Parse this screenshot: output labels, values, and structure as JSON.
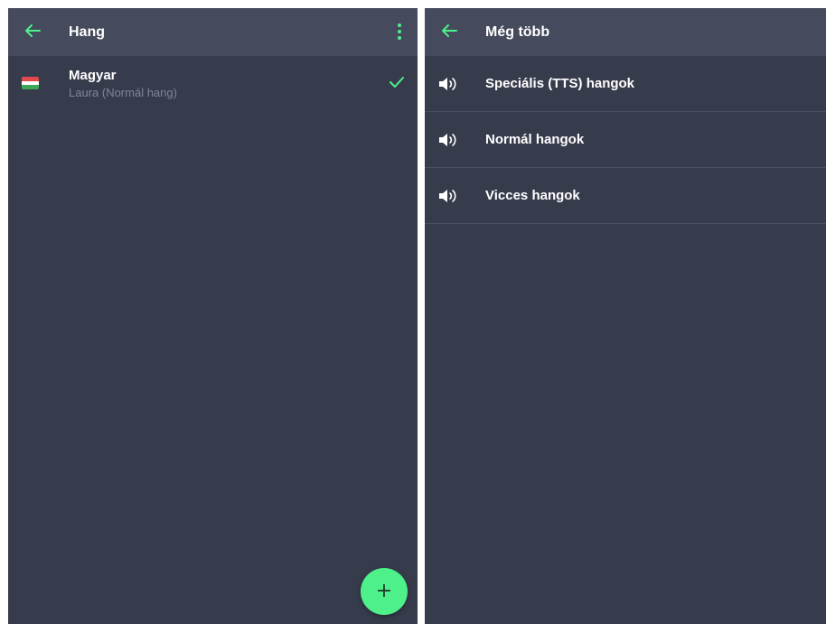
{
  "left_panel": {
    "title": "Hang",
    "language": {
      "name": "Magyar",
      "voice": "Laura (Normál hang)"
    },
    "fab_label": "+"
  },
  "right_panel": {
    "title": "Még több",
    "items": [
      {
        "label": "Speciális (TTS) hangok"
      },
      {
        "label": "Normál hangok"
      },
      {
        "label": "Vicces hangok"
      }
    ]
  },
  "colors": {
    "accent": "#4ef08a",
    "background": "#373c4d",
    "appbar": "#454a5c",
    "subtext": "#7f8597"
  }
}
